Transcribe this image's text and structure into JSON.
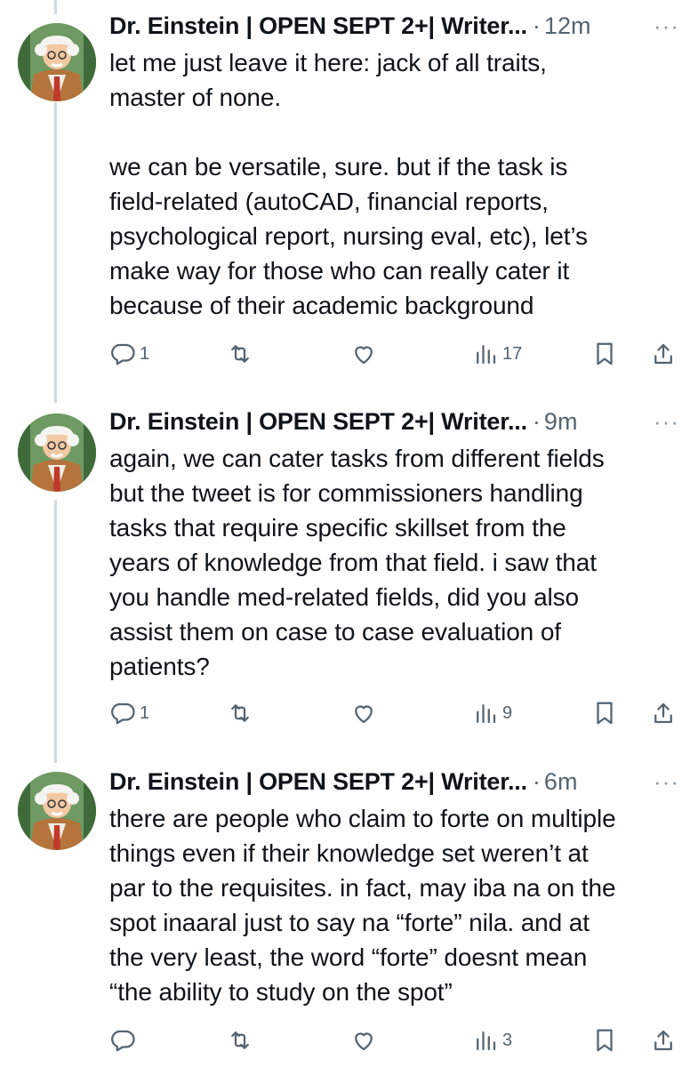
{
  "tweets": [
    {
      "display_name": "Dr. Einstein | OPEN SEPT 2+| Writer...",
      "separator": "·",
      "time": "12m",
      "more": "···",
      "text": "let me just leave it here: jack of all traits,\nmaster of none.\n\nwe can be versatile, sure. but if the task is\nfield-related (autoCAD, financial reports,\npsychological report, nursing eval, etc), let’s\nmake way for those who can really cater it\nbecause of their academic background",
      "replies": "1",
      "retweets": "",
      "likes": "",
      "views": "17"
    },
    {
      "display_name": "Dr. Einstein | OPEN SEPT 2+| Writer...",
      "separator": "·",
      "time": "9m",
      "more": "···",
      "text": "again, we can cater tasks from different fields\nbut the tweet is for commissioners handling\ntasks that require specific skillset from the\nyears of knowledge from that field. i saw that\nyou handle med-related fields, did you also\nassist them on case to case evaluation of\npatients?",
      "replies": "1",
      "retweets": "",
      "likes": "",
      "views": "9"
    },
    {
      "display_name": "Dr. Einstein | OPEN SEPT 2+| Writer...",
      "separator": "·",
      "time": "6m",
      "more": "···",
      "text": "there are people who claim to forte on multiple\nthings even if their knowledge set weren’t at\npar to the requisites. in fact, may iba na on the\nspot inaaral just to say na “forte” nila. and at\nthe very least, the word “forte” doesnt mean\n“the ability to study on the spot”",
      "replies": "",
      "retweets": "",
      "likes": "",
      "views": "3"
    }
  ],
  "icons": [
    "reply-icon",
    "retweet-icon",
    "like-icon",
    "views-icon",
    "bookmark-icon",
    "share-icon"
  ],
  "colors": {
    "text": "#0f1419",
    "secondary": "#536471",
    "thread_line": "#cfd9de"
  }
}
